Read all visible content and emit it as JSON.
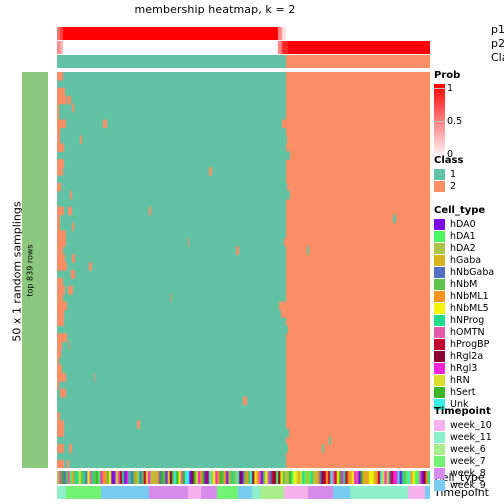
{
  "title": "membership heatmap, k = 2",
  "left_labels": {
    "outer": "50 x 1 random samplings",
    "inner": "top 839 rows"
  },
  "top_annotations": [
    {
      "name": "p1",
      "label": "p1"
    },
    {
      "name": "p2",
      "label": "p2"
    },
    {
      "name": "Class",
      "label": "Class"
    }
  ],
  "bottom_annotations": [
    {
      "name": "Cell_type",
      "label": "Cell_type"
    },
    {
      "name": "Timepoint",
      "label": "Timepoint"
    }
  ],
  "legends": {
    "prob": {
      "title": "Prob",
      "ticks": [
        "1",
        "0.5",
        "0"
      ],
      "min": 0,
      "max": 1,
      "color_high": "#FF0000",
      "color_low": "#FFFFFF"
    },
    "class": {
      "title": "Class",
      "items": [
        {
          "label": "1",
          "color": "#62C2A4"
        },
        {
          "label": "2",
          "color": "#FB8E64"
        }
      ]
    },
    "cell_type": {
      "title": "Cell_type",
      "items": [
        {
          "label": "hDA0",
          "color": "#7D0BE8"
        },
        {
          "label": "hDA1",
          "color": "#4DF763"
        },
        {
          "label": "hDA2",
          "color": "#AEC448"
        },
        {
          "label": "hGaba",
          "color": "#D6B41E"
        },
        {
          "label": "hNbGaba",
          "color": "#5271C0"
        },
        {
          "label": "hNbM",
          "color": "#5FC44D"
        },
        {
          "label": "hNbML1",
          "color": "#F79420"
        },
        {
          "label": "hNbML5",
          "color": "#F6F60A"
        },
        {
          "label": "hNProg",
          "color": "#21DC8C"
        },
        {
          "label": "hOMTN",
          "color": "#E25BAC"
        },
        {
          "label": "hProgBP",
          "color": "#C20030"
        },
        {
          "label": "hRgl2a",
          "color": "#8C0034"
        },
        {
          "label": "hRgl3",
          "color": "#F524DA"
        },
        {
          "label": "hRN",
          "color": "#DBE02A"
        },
        {
          "label": "hSert",
          "color": "#3AB528"
        },
        {
          "label": "Unk",
          "color": "#3DEEE2"
        }
      ]
    },
    "timepoint": {
      "title": "Timepoint",
      "items": [
        {
          "label": "week_10",
          "color": "#F7B2EE"
        },
        {
          "label": "week_11",
          "color": "#8DEFCB"
        },
        {
          "label": "week_6",
          "color": "#A8EE8A"
        },
        {
          "label": "week_7",
          "color": "#72F374"
        },
        {
          "label": "week_8",
          "color": "#D68BEB"
        },
        {
          "label": "week_9",
          "color": "#79CBEF"
        }
      ]
    }
  },
  "heatmap": {
    "class1_color": "#62C2A4",
    "class2_color": "#FB8E64",
    "boundary_fraction": 0.615,
    "n_rows": 50,
    "n_cols": 172,
    "rowblock_color": "#8CC97F"
  },
  "prob_rows": {
    "p1_color": "#FF0000",
    "p2_color": "#FF0000",
    "background": "#FFFFFF"
  }
}
